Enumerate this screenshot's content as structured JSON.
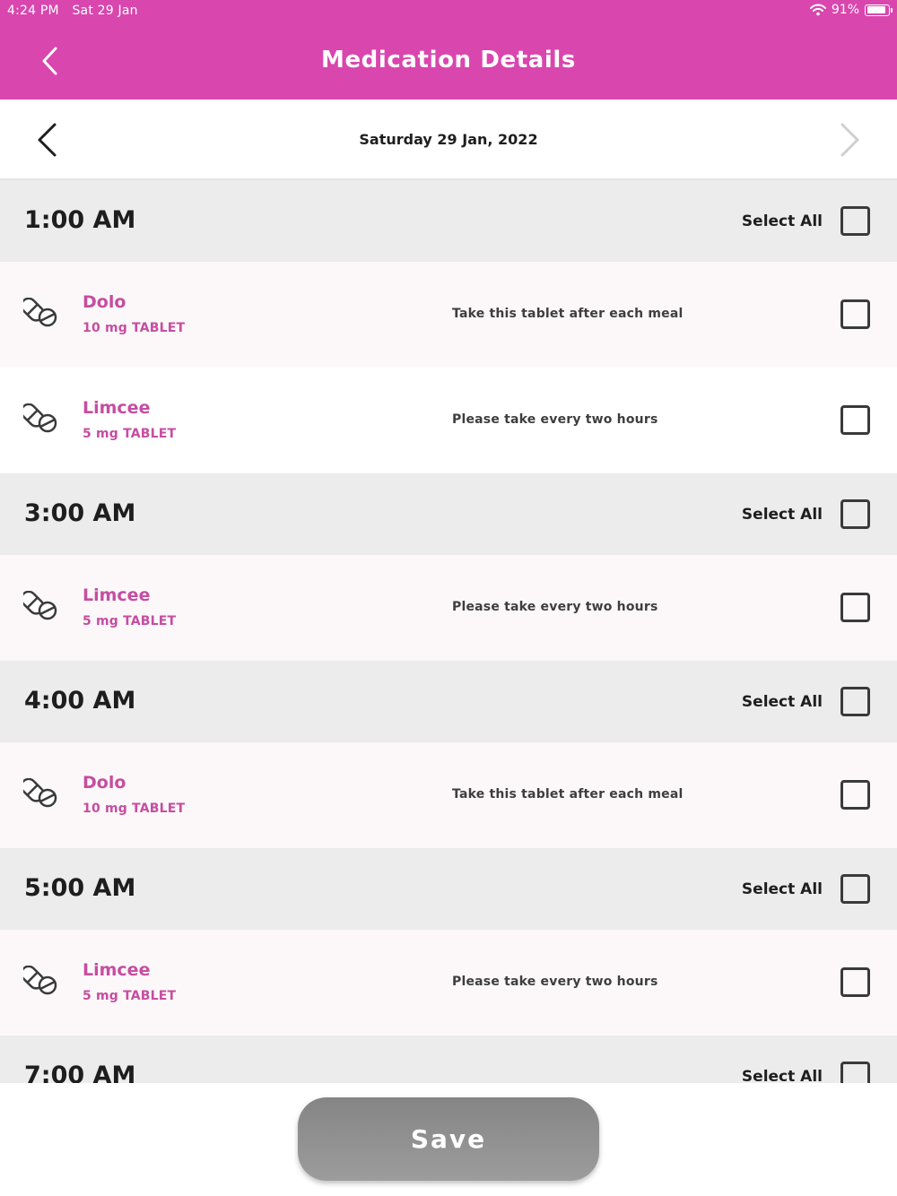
{
  "status_bar": {
    "time": "4:24 PM",
    "date": "Sat 29 Jan",
    "battery": "91%",
    "battery_level": 0.91
  },
  "header": {
    "title": "Medication Details"
  },
  "date_nav": {
    "label": "Saturday 29 Jan, 2022"
  },
  "select_all_label": "Select All",
  "slots": [
    {
      "time": "1:00 AM",
      "meds": [
        {
          "name": "Dolo",
          "dose": "10 mg TABLET",
          "note": "Take this tablet after each meal"
        },
        {
          "name": "Limcee",
          "dose": "5 mg TABLET",
          "note": "Please take every two hours"
        }
      ]
    },
    {
      "time": "3:00 AM",
      "meds": [
        {
          "name": "Limcee",
          "dose": "5 mg TABLET",
          "note": "Please take every two hours"
        }
      ]
    },
    {
      "time": "4:00 AM",
      "meds": [
        {
          "name": "Dolo",
          "dose": "10 mg TABLET",
          "note": "Take this tablet after each meal"
        }
      ]
    },
    {
      "time": "5:00 AM",
      "meds": [
        {
          "name": "Limcee",
          "dose": "5 mg TABLET",
          "note": "Please take every two hours"
        }
      ]
    },
    {
      "time": "7:00 AM",
      "meds": []
    }
  ],
  "save_button": {
    "label": "Save"
  },
  "colors": {
    "brand": "#d946ae",
    "med_text": "#c64da1",
    "header_bg": "#ececec"
  },
  "icons": {
    "back": "chevron-left-icon",
    "pill": "pill-icon",
    "wifi": "wifi-icon",
    "battery": "battery-icon"
  }
}
